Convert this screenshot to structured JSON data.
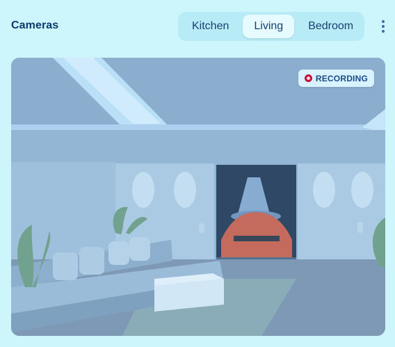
{
  "header": {
    "title": "Cameras"
  },
  "tabs": [
    {
      "label": "Kitchen",
      "active": false
    },
    {
      "label": "Living",
      "active": true
    },
    {
      "label": "Bedroom",
      "active": false
    }
  ],
  "menu": {
    "icon": "more-vertical-icon"
  },
  "feed": {
    "status_label": "RECORDING",
    "status_icon": "record-icon",
    "scene": "living-room camera view"
  },
  "colors": {
    "accent": "#0d3a6e",
    "recording": "#c2123b",
    "background": "#ccf6fc"
  }
}
